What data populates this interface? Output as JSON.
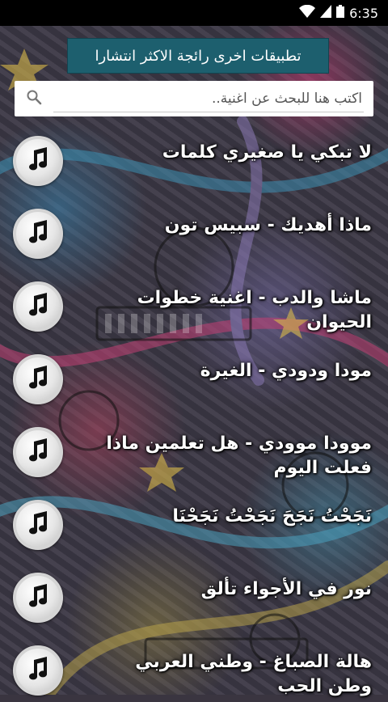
{
  "status_bar": {
    "time": "6:35"
  },
  "banner": {
    "label": "تطبيقات اخرى رائجة الاكثر انتشارا"
  },
  "search": {
    "placeholder": "اكتب هنا للبحث عن اغنية.."
  },
  "songs": [
    {
      "title": "لا تبكي يا صغيري كلمات"
    },
    {
      "title": "ماذا أهديك - سبيس تون"
    },
    {
      "title": "ماشا والدب - اغنية خطوات الحيوان"
    },
    {
      "title": "مودا ودودي - الغيرة"
    },
    {
      "title": "موودا موودي - هل تعلمين ماذا فعلت اليوم"
    },
    {
      "title": "نَجَحْتُ نَجَحَ نَجَحْتُ نَجَحْنَا"
    },
    {
      "title": "نور في الأجواء تألق"
    },
    {
      "title": "هالة الصباغ - وطني العربي وطن الحب"
    }
  ],
  "icons": {
    "song": "music-note-icon",
    "search": "search-icon",
    "wifi": "wifi-icon",
    "signal": "signal-icon",
    "battery": "battery-icon"
  }
}
